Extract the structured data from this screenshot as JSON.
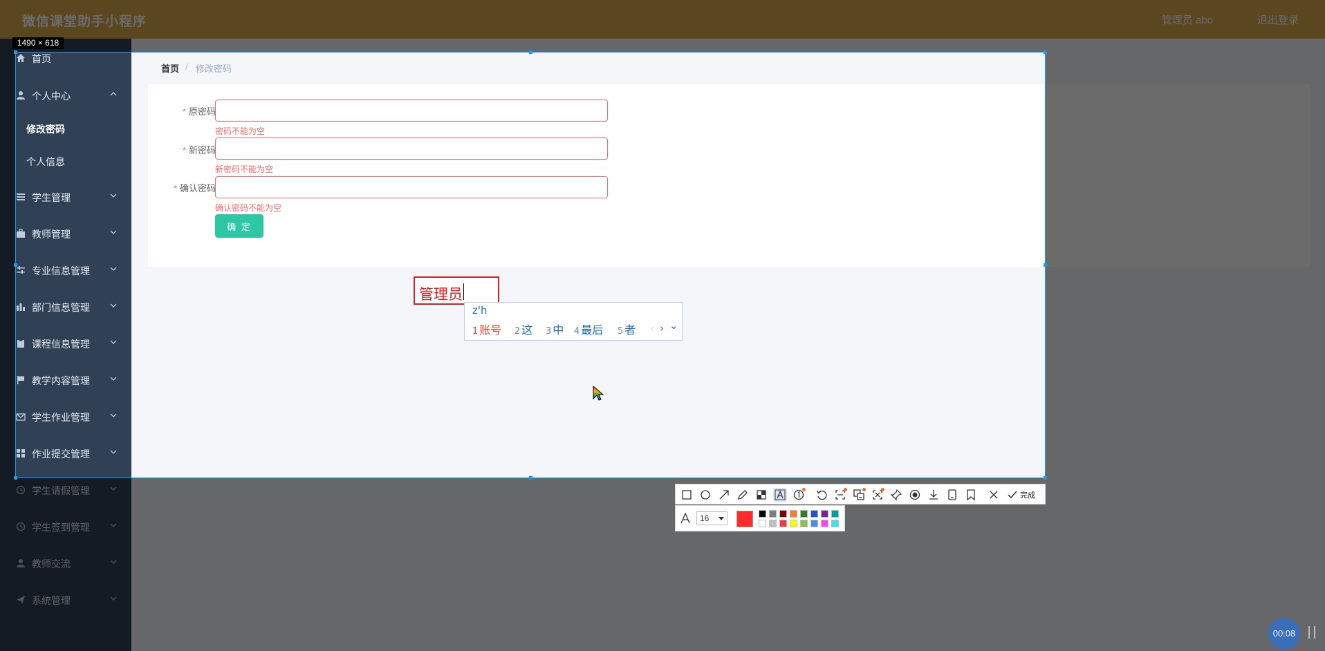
{
  "app": {
    "title": "微信课堂助手小程序",
    "user_text": "管理员 abo",
    "logout_text": "退出登录"
  },
  "sidebar": {
    "items": [
      {
        "label": "首页",
        "icon": "home-icon"
      },
      {
        "label": "个人中心",
        "icon": "user-icon",
        "expanded": true
      },
      {
        "label": "学生管理",
        "icon": "list-icon"
      },
      {
        "label": "教师管理",
        "icon": "briefcase-icon"
      },
      {
        "label": "专业信息管理",
        "icon": "sliders-icon"
      },
      {
        "label": "部门信息管理",
        "icon": "bar-chart-icon"
      },
      {
        "label": "课程信息管理",
        "icon": "clipboard-icon"
      },
      {
        "label": "教学内容管理",
        "icon": "flag-icon"
      },
      {
        "label": "学生作业管理",
        "icon": "mail-icon"
      },
      {
        "label": "作业提交管理",
        "icon": "grid-icon"
      },
      {
        "label": "学生请假管理",
        "icon": "clock-icon"
      },
      {
        "label": "学生签到管理",
        "icon": "clock-icon"
      },
      {
        "label": "教师交流",
        "icon": "user-icon"
      },
      {
        "label": "系统管理",
        "icon": "send-icon"
      }
    ],
    "subitems": [
      {
        "label": "修改密码",
        "active": true
      },
      {
        "label": "个人信息",
        "active": false
      }
    ]
  },
  "breadcrumb": {
    "home": "首页",
    "separator": "/",
    "current": "修改密码"
  },
  "form": {
    "fields": [
      {
        "label": "原密码",
        "value": "",
        "error": "密码不能为空"
      },
      {
        "label": "新密码",
        "value": "",
        "error": "新密码不能为空"
      },
      {
        "label": "确认密码",
        "value": "",
        "error": "确认密码不能为空"
      }
    ],
    "required_mark": "*",
    "submit_label": "确 定"
  },
  "screenshot_tool": {
    "size_label": "1490 × 618",
    "annotation_text": "管理员",
    "ime": {
      "composition": "z'h",
      "candidates": [
        {
          "num": "1",
          "text": "账号"
        },
        {
          "num": "2",
          "text": "这"
        },
        {
          "num": "3",
          "text": "中"
        },
        {
          "num": "4",
          "text": "最后"
        },
        {
          "num": "5",
          "text": "者"
        }
      ],
      "prev": "‹",
      "next": "›",
      "expand": "⌄"
    },
    "toolbar": {
      "tools": [
        "rectangle-icon",
        "ellipse-icon",
        "arrow-icon",
        "pencil-icon",
        "mosaic-icon",
        "text-tool-icon",
        "number-marker-icon",
        "undo-icon",
        "screenshot-tool-icon",
        "translate-icon",
        "scroll-capture-icon",
        "pin-icon",
        "record-icon",
        "download-icon",
        "save-icon",
        "bookmark-icon",
        "close-icon",
        "check-icon"
      ],
      "done_label": "完成"
    },
    "text_options": {
      "font_size": "16",
      "current_color": "#ff2a2a",
      "palette": [
        "#000000",
        "#808080",
        "#800000",
        "#f07f3c",
        "#2e7d32",
        "#2255cc",
        "#7b1fa2",
        "#00a0a0",
        "#ffffff",
        "#c0c0c0",
        "#f23a3a",
        "#ffff00",
        "#8bc34a",
        "#4a90e2",
        "#ff40ff",
        "#40e0f0"
      ]
    }
  },
  "recorder": {
    "time": "00:08"
  },
  "colors": {
    "header": "#d6a84b",
    "sidebar": "#304156",
    "accent_button": "#2dc8a3",
    "error": "#f56c6c",
    "selection": "#1a9bf5",
    "annotation": "#e02020"
  }
}
